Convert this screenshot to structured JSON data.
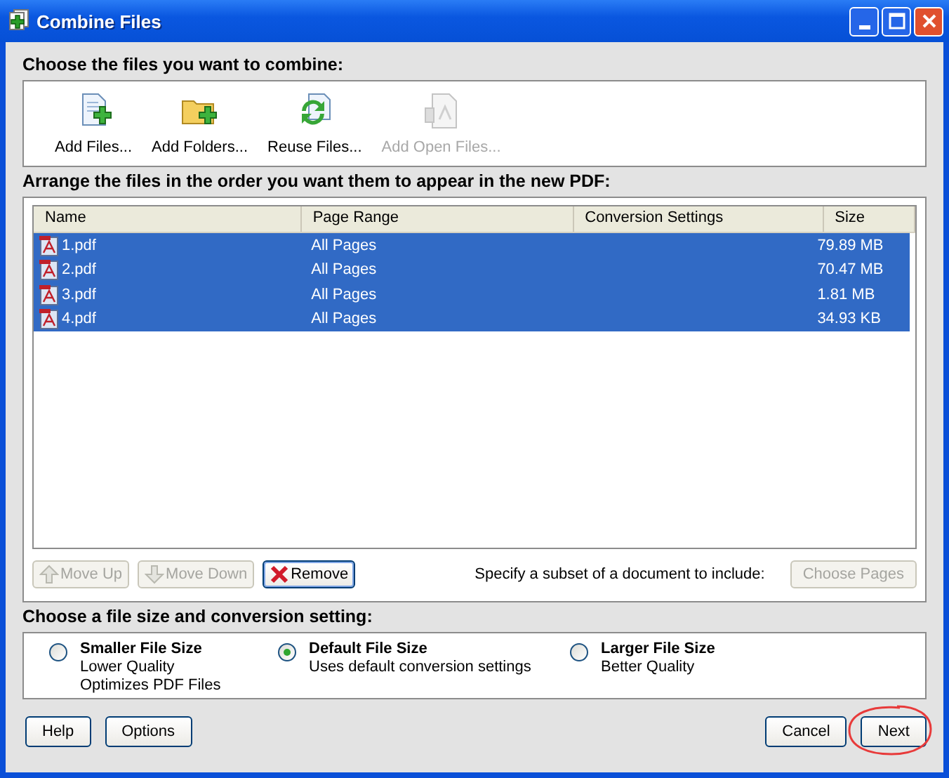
{
  "window": {
    "title": "Combine Files"
  },
  "add_section": {
    "heading": "Choose the files you want to combine:",
    "tools": [
      {
        "kind": "file",
        "label": "Add Files...",
        "disabled": false
      },
      {
        "kind": "folder",
        "label": "Add Folders...",
        "disabled": false
      },
      {
        "kind": "reuse",
        "label": "Reuse Files...",
        "disabled": false
      },
      {
        "kind": "open",
        "label": "Add Open Files...",
        "disabled": true
      }
    ]
  },
  "files": {
    "heading": "Arrange the files in the order you want them to appear in the new PDF:",
    "columns": [
      "Name",
      "Page Range",
      "Conversion Settings",
      "Size"
    ],
    "rows": [
      {
        "name": "1.pdf",
        "page_range": "All Pages",
        "size": "79.89 MB",
        "selected": true
      },
      {
        "name": "2.pdf",
        "page_range": "All Pages",
        "size": "70.47 MB",
        "selected": true
      },
      {
        "name": "3.pdf",
        "page_range": "All Pages",
        "size": "1.81 MB",
        "selected": true
      },
      {
        "name": "4.pdf",
        "page_range": "All Pages",
        "size": "34.93 KB",
        "selected": true
      }
    ],
    "buttons": [
      {
        "kind": "up",
        "label": "Move Up",
        "disabled": true
      },
      {
        "kind": "down",
        "label": "Move Down",
        "disabled": true
      },
      {
        "kind": "remove",
        "label": "Remove",
        "disabled": false
      }
    ],
    "subset_label": "Specify a subset of a document to include:",
    "choose_pages": {
      "label": "Choose Pages",
      "disabled": true
    }
  },
  "size_section": {
    "heading": "Choose a file size and conversion setting:",
    "options": [
      {
        "title": "Smaller File Size",
        "lines": [
          "Lower Quality",
          "Optimizes PDF Files"
        ],
        "selected": false
      },
      {
        "title": "Default File Size",
        "lines": [
          "Uses default conversion settings"
        ],
        "selected": true
      },
      {
        "title": "Larger File Size",
        "lines": [
          "Better Quality"
        ],
        "selected": false
      }
    ]
  },
  "footer": {
    "left": [
      "Help",
      "Options"
    ],
    "right": [
      {
        "label": "Cancel",
        "circled": false
      },
      {
        "label": "Next",
        "circled": true
      }
    ]
  }
}
